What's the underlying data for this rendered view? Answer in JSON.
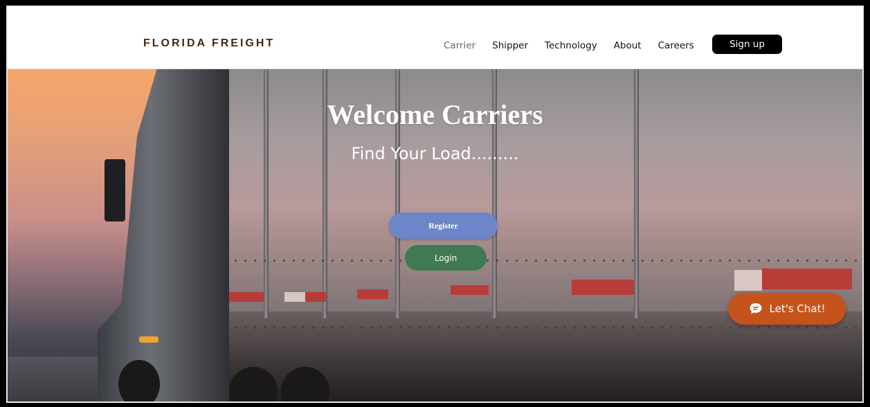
{
  "header": {
    "brand": "FLORIDA FREIGHT",
    "nav": [
      {
        "label": "Carrier",
        "active": true
      },
      {
        "label": "Shipper"
      },
      {
        "label": "Technology"
      },
      {
        "label": "About"
      },
      {
        "label": "Careers"
      }
    ],
    "signup_label": "Sign up"
  },
  "hero": {
    "title": "Welcome Carriers",
    "subtitle": "Find Your Load.........",
    "register_label": "Register",
    "login_label": "Login",
    "background_icon": "truck-trailer-image"
  },
  "chat": {
    "label": "Let's Chat!",
    "icon": "chat-bubble-icon",
    "color": "#c5541c"
  },
  "colors": {
    "brand": "#4a2508",
    "register": "#6c86c9",
    "login": "#3f7a52",
    "signup": "#000000"
  }
}
